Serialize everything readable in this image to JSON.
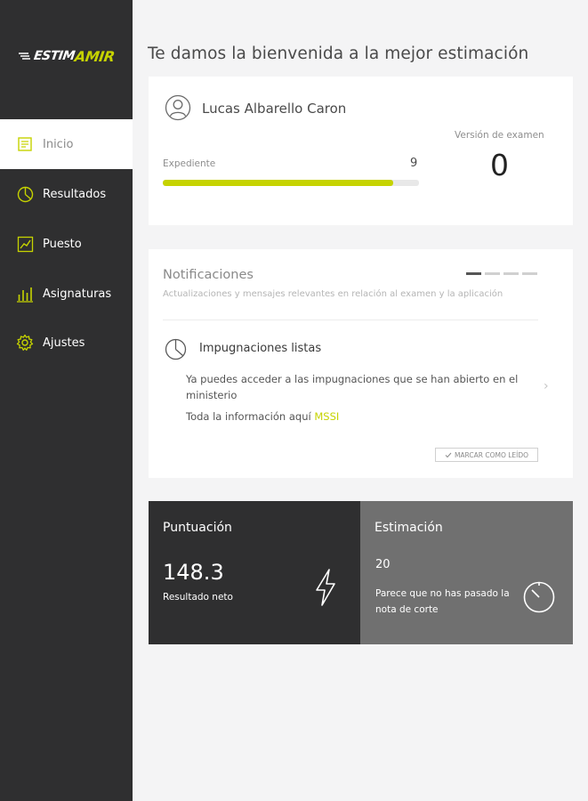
{
  "brand": {
    "logo_text_a": "ESTIM",
    "logo_text_b": "AMIR",
    "accent": "#c6d300",
    "sidebar_bg": "#2f2f30"
  },
  "sidebar": {
    "items": [
      {
        "label": "Inicio",
        "icon": "home-icon",
        "active": true
      },
      {
        "label": "Resultados",
        "icon": "pie-chart-icon",
        "active": false
      },
      {
        "label": "Puesto",
        "icon": "line-chart-icon",
        "active": false
      },
      {
        "label": "Asignaturas",
        "icon": "bar-chart-icon",
        "active": false
      },
      {
        "label": "Ajustes",
        "icon": "gear-icon",
        "active": false
      }
    ]
  },
  "main": {
    "title": "Te damos la bienvenida a la mejor estimación"
  },
  "user_card": {
    "name": "Lucas Albarello Caron",
    "expediente_label": "Expediente",
    "expediente_value": "9",
    "expediente_progress": 0.9,
    "version_label": "Versión de examen",
    "version_value": "0"
  },
  "notifications": {
    "title": "Notificaciones",
    "subtitle": "Actualizaciones y mensajes relevantes en relación al examen y la aplicación",
    "pager": {
      "count": 4,
      "active_index": 0
    },
    "item": {
      "title": "Impugnaciones listas",
      "body": "Ya puedes acceder a las impugnaciones que se han abierto en el ministerio",
      "info_prefix": "Toda la información aquí",
      "info_link": "MSSI",
      "mark_read": "MARCAR COMO LEÍDO"
    }
  },
  "score": {
    "title": "Puntuación",
    "value": "148.3",
    "caption": "Resultado neto",
    "icon": "bolt-icon"
  },
  "estimation": {
    "title": "Estimación",
    "value": "20",
    "text": "Parece que no has pasado la nota de corte",
    "icon": "timer-icon"
  }
}
